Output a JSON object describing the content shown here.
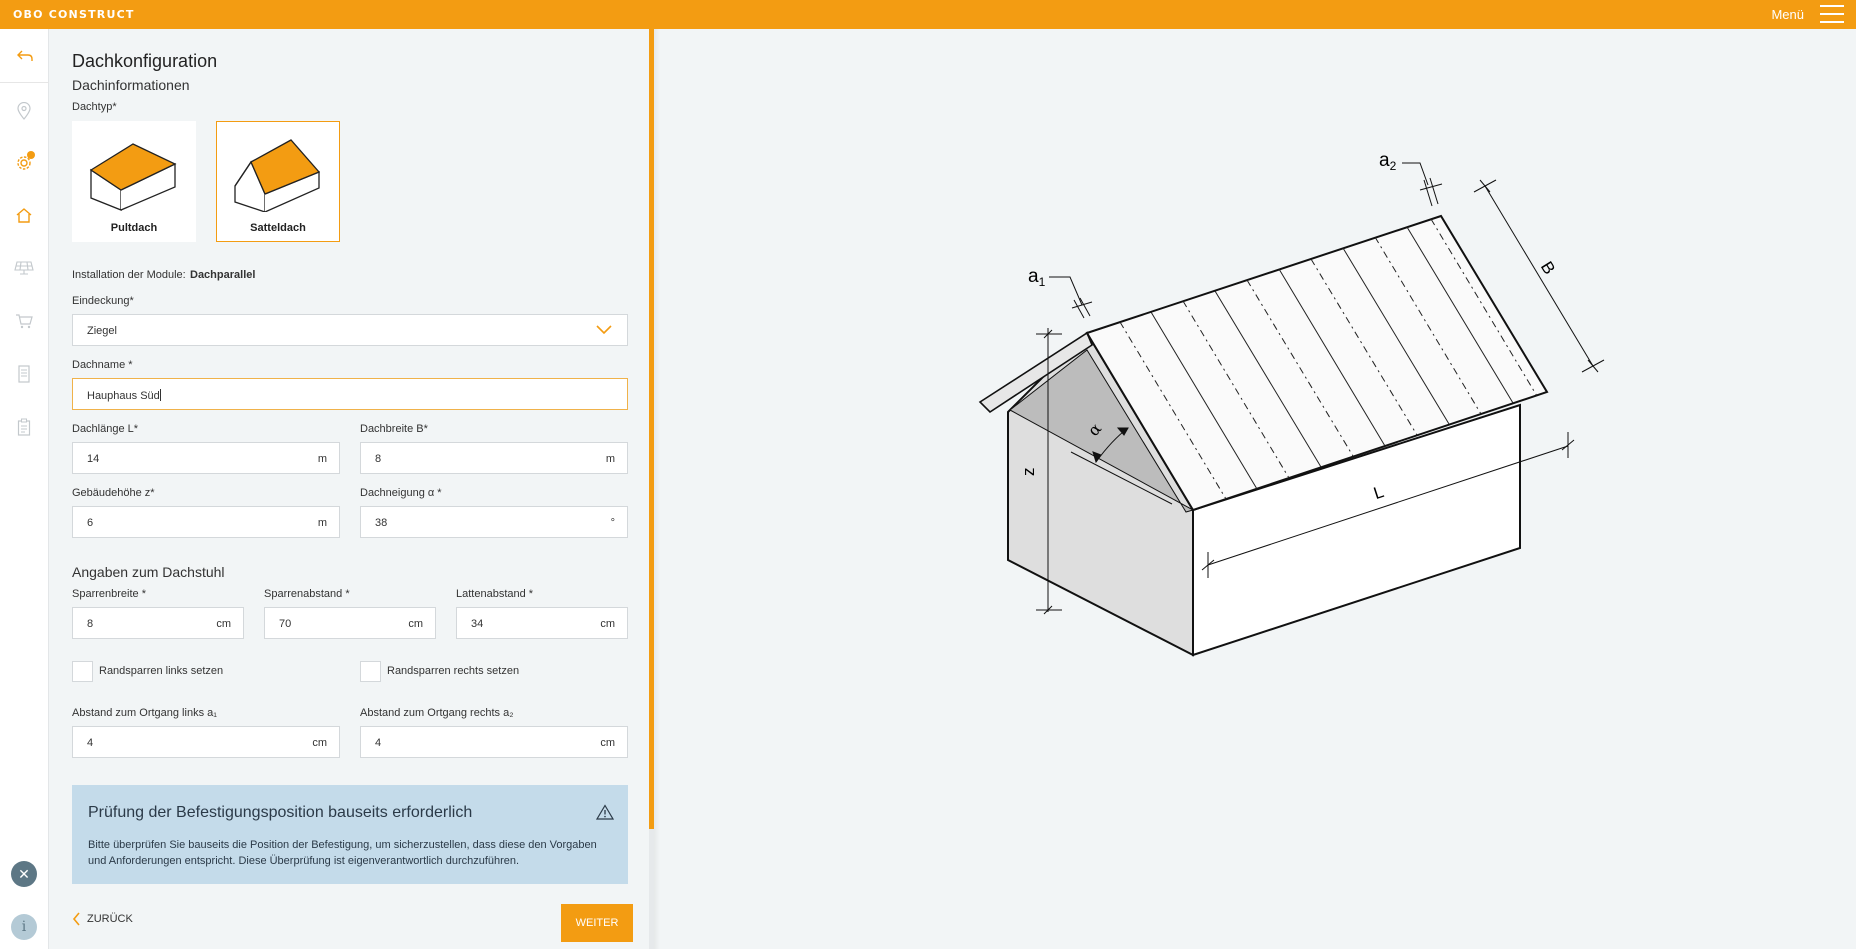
{
  "header": {
    "logo": "OBO CONSTRUCT",
    "menu_label": "Menü"
  },
  "page": {
    "title": "Dachkonfiguration",
    "subtitle": "Dachinformationen"
  },
  "roof_type": {
    "label": "Dachtyp*",
    "options": [
      {
        "label": "Pultdach",
        "selected": false
      },
      {
        "label": "Satteldach",
        "selected": true
      }
    ]
  },
  "installation": {
    "label": "Installation der Module:",
    "value": "Dachparallel"
  },
  "eindeckung": {
    "label": "Eindeckung*",
    "value": "Ziegel"
  },
  "dachname": {
    "label": "Dachname *",
    "value": "Hauphaus Süd"
  },
  "dachlaenge": {
    "label": "Dachlänge L*",
    "value": "14",
    "unit": "m"
  },
  "dachbreite": {
    "label": "Dachbreite B*",
    "value": "8",
    "unit": "m"
  },
  "gebaeudehoehe": {
    "label": "Gebäudehöhe z*",
    "value": "6",
    "unit": "m"
  },
  "dachneigung": {
    "label": "Dachneigung α *",
    "value": "38",
    "unit": "°"
  },
  "dachstuhl": {
    "title": "Angaben zum Dachstuhl",
    "sparrenbreite": {
      "label": "Sparrenbreite *",
      "value": "8",
      "unit": "cm"
    },
    "sparrenabstand": {
      "label": "Sparrenabstand *",
      "value": "70",
      "unit": "cm"
    },
    "lattenabstand": {
      "label": "Lattenabstand *",
      "value": "34",
      "unit": "cm"
    }
  },
  "checkboxes": {
    "links": {
      "label": "Randsparren links setzen",
      "checked": false
    },
    "rechts": {
      "label": "Randsparren rechts setzen",
      "checked": false
    }
  },
  "ortgang": {
    "links": {
      "label": "Abstand zum Ortgang links a₁",
      "value": "4",
      "unit": "cm"
    },
    "rechts": {
      "label": "Abstand zum Ortgang rechts a₂",
      "value": "4",
      "unit": "cm"
    }
  },
  "alert": {
    "title": "Prüfung der Befestigungsposition bauseits erforderlich",
    "text": "Bitte überprüfen Sie bauseits die Position der Befestigung, um sicherzustellen, dass diese den Vorgaben und Anforderungen entspricht. Diese Überprüfung ist eigenverantwortlich durchzuführen."
  },
  "footer": {
    "back_label": "ZURÜCK",
    "next_label": "WEITER"
  },
  "drawing_labels": {
    "a1": "a",
    "a1_sub": "1",
    "a2": "a",
    "a2_sub": "2",
    "b": "B",
    "l": "L",
    "z": "z",
    "alpha": "α"
  },
  "colors": {
    "accent": "#f39c12",
    "alert_bg": "#c4dbea",
    "background": "#f2f5f6"
  },
  "rail_icons": [
    "back-arrow-icon",
    "location-pin-icon",
    "settings-gear-icon",
    "house-icon",
    "solar-panel-icon",
    "cart-icon",
    "document-icon",
    "clipboard-icon",
    "close-icon",
    "info-icon"
  ]
}
